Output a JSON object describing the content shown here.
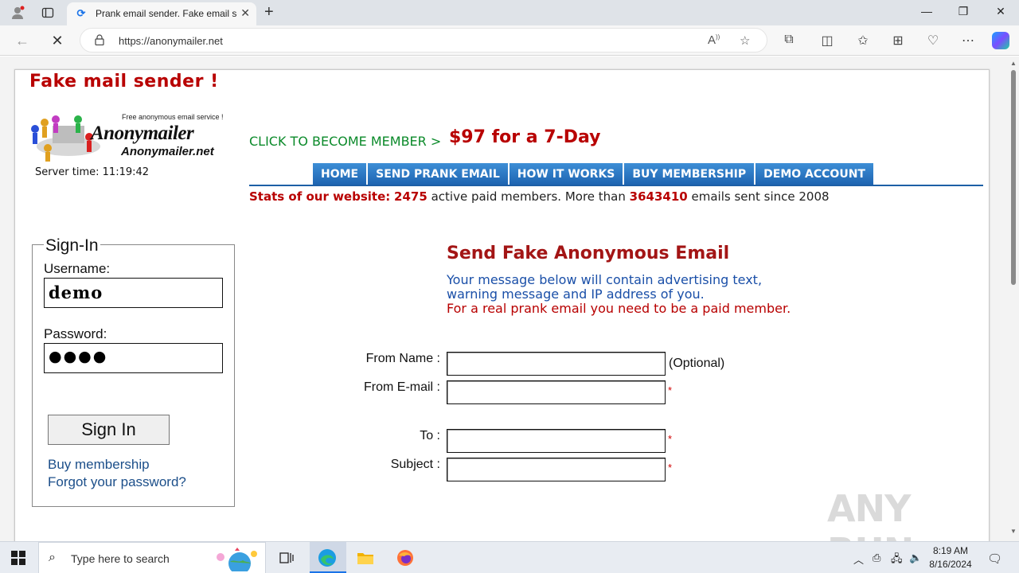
{
  "browser": {
    "tab_title": "Prank email sender. Fake email se",
    "url": "https://anonymailer.net"
  },
  "page": {
    "site_title": "Fake mail sender !",
    "logo": {
      "tagline": "Free anonymous email service !",
      "name": "Anonymailer",
      "domain": "Anonymailer.net"
    },
    "server_time": "Server time: 11:19:42",
    "cta_text": "CLICK TO BECOME MEMBER >",
    "cta_price": "$97 for a 7-Day",
    "menu": [
      {
        "label": "HOME"
      },
      {
        "label": "SEND PRANK EMAIL"
      },
      {
        "label": "HOW IT WORKS"
      },
      {
        "label": "BUY MEMBERSHIP"
      },
      {
        "label": "DEMO ACCOUNT"
      }
    ],
    "stats": {
      "prefix": "Stats of our website:",
      "members_count": "2475",
      "members_text": "active paid members. More than",
      "emails_count": "3643410",
      "emails_text": "emails sent since 2008"
    },
    "signin": {
      "legend": "Sign-In",
      "username_label": "Username:",
      "username_value": "demo",
      "password_label": "Password:",
      "password_value": "●●●●",
      "button_label": "Sign In",
      "buy_link": "Buy membership",
      "forgot_link": "Forgot your password?"
    },
    "form": {
      "heading": "Send Fake Anonymous Email",
      "note_line1": "Your message below will contain advertising text,",
      "note_line2": "warning message and IP address of you.",
      "note_line3": "For a real prank email you need to be a paid member.",
      "from_name_label": "From Name :",
      "from_name_hint": "(Optional)",
      "from_email_label": "From E-mail :",
      "to_label": "To :",
      "subject_label": "Subject :",
      "required_mark": "*"
    },
    "watermark": "ANY RUN"
  },
  "taskbar": {
    "search_placeholder": "Type here to search",
    "time": "8:19 AM",
    "date": "8/16/2024"
  },
  "colors": {
    "brand_red": "#b80000",
    "cta_green": "#0b8a2a",
    "menu_blue": "#1d63b0",
    "link_blue": "#1c4f8a"
  }
}
